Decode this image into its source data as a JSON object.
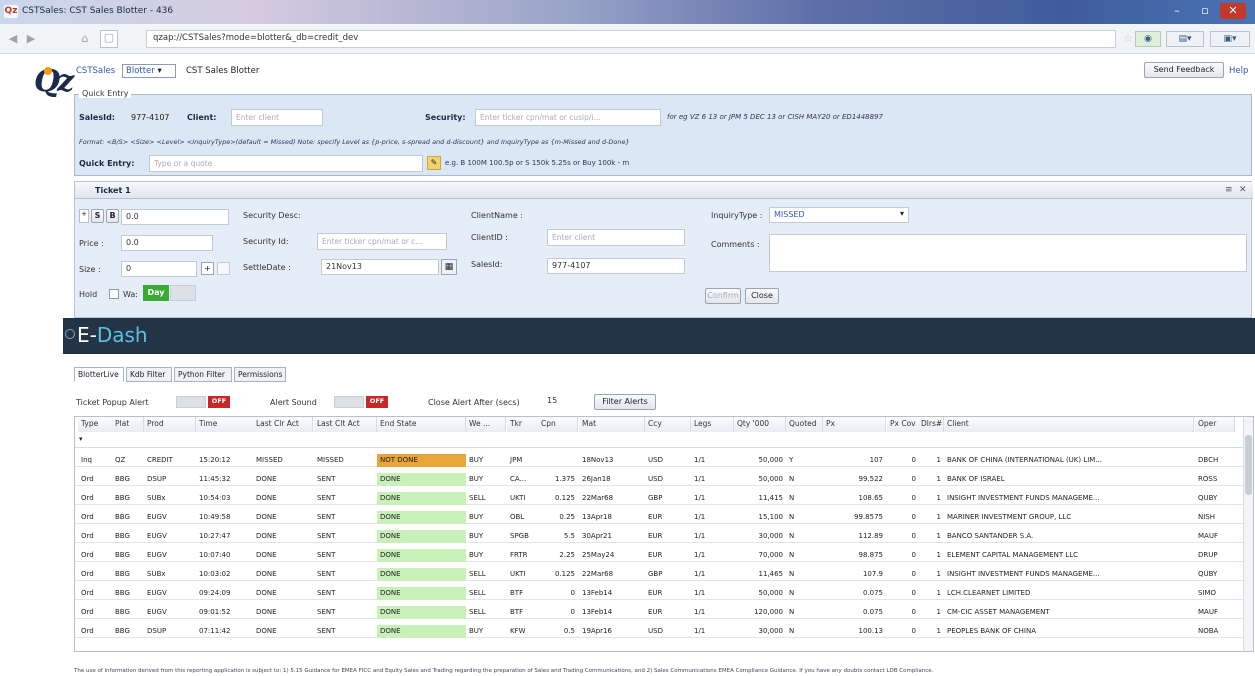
{
  "window": {
    "title": "CSTSales: CST Sales Blotter - 436",
    "icon": "Qz"
  },
  "browser": {
    "url": "qzap://CSTSales?mode=blotter&_db=credit_dev"
  },
  "header": {
    "breadcrumb": "CSTSales",
    "view_select": "Blotter",
    "page_title": "CST Sales Blotter",
    "feedback_label": "Send Feedback",
    "help_label": "Help"
  },
  "quick_entry": {
    "legend": "Quick Entry",
    "salesid_label": "SalesId:",
    "salesid_value": "977-4107",
    "client_label": "Client:",
    "client_placeholder": "Enter client",
    "security_label": "Security:",
    "security_placeholder": "Enter ticker cpn/mat or cusip/i...",
    "security_hint": "for eg VZ 6 13 or JPM 5 DEC 13 or CISH MAY20 or ED1448897",
    "format_text": "Format: <B/S> <Size> <Level> <InquiryType>(default = Missed) Note: specify Level as {p-price, s-spread and d-discount} and InquiryType as {m-Missed and d-Done}",
    "qe_label": "Quick Entry:",
    "qe_placeholder": "Type or a quote",
    "qe_hint": "e.g. B 100M 100.5p or S 150k 5.25s or Buy 100k - m"
  },
  "ticket": {
    "tab_label": "Ticket 1",
    "side_s": "S",
    "side_b": "B",
    "qty": "0.0",
    "price_label": "Price :",
    "price_value": "0.0",
    "size_label": "Size :",
    "size_value": "0",
    "hold_label": "Hold",
    "wait_label": "Wa:",
    "day_label": "Day",
    "sec_desc_label": "Security Desc:",
    "sec_id_label": "Security Id:",
    "sec_id_placeholder": "Enter ticker cpn/mat or c...",
    "settle_label": "SettleDate :",
    "settle_value": "21Nov13",
    "client_name_label": "ClientName :",
    "client_id_label": "ClientID :",
    "client_id_placeholder": "Enter client",
    "salesid_label": "SalesId:",
    "salesid_value": "977-4107",
    "inquiry_label": "InquiryType :",
    "inquiry_value": "MISSED",
    "comments_label": "Comments :",
    "confirm_label": "Confirm",
    "close_label": "Close"
  },
  "dash": {
    "title_e": "E-",
    "title_dash": "Dash"
  },
  "tabs": [
    "BlotterLive",
    "Kdb Filter",
    "Python Filter",
    "Permissions"
  ],
  "alerts": {
    "popup_label": "Ticket Popup Alert",
    "popup_state": "OFF",
    "sound_label": "Alert Sound",
    "sound_state": "OFF",
    "close_after_label": "Close Alert After (secs)",
    "close_after_value": "15",
    "filter_button": "Filter Alerts"
  },
  "columns": [
    "Type",
    "Plat",
    "Prod",
    "Time",
    "Last Clr Act",
    "Last Clt Act",
    "End State",
    "We ...",
    "Tkr",
    "Cpn",
    "Mat",
    "Ccy",
    "Legs",
    "Qty '000",
    "Quoted",
    "Px",
    "Px Cov",
    "Dlrs#",
    "Client",
    "Oper"
  ],
  "rows": [
    [
      "Inq",
      "QZ",
      "CREDIT",
      "15:20:12",
      "MISSED",
      "MISSED",
      "NOT DONE",
      "BUY",
      "JPM",
      "",
      "18Nov13",
      "USD",
      "1/1",
      "50,000",
      "Y",
      "107",
      "0",
      "1",
      "BANK OF CHINA (INTERNATIONAL (UK) LIM...",
      "DBCH"
    ],
    [
      "Ord",
      "BBG",
      "DSUP",
      "11:45:32",
      "DONE",
      "SENT",
      "DONE",
      "BUY",
      "CA...",
      "1.375",
      "26Jan18",
      "USD",
      "1/1",
      "50,000",
      "N",
      "99.522",
      "0",
      "1",
      "BANK OF ISRAEL",
      "ROSS"
    ],
    [
      "Ord",
      "BBG",
      "SUBx",
      "10:54:03",
      "DONE",
      "SENT",
      "DONE",
      "SELL",
      "UKTI",
      "0.125",
      "22Mar68",
      "GBP",
      "1/1",
      "11,415",
      "N",
      "108.65",
      "0",
      "1",
      "INSIGHT INVESTMENT FUNDS MANAGEME...",
      "QUBY"
    ],
    [
      "Ord",
      "BBG",
      "EUGV",
      "10:49:58",
      "DONE",
      "SENT",
      "DONE",
      "BUY",
      "OBL",
      "0.25",
      "13Apr18",
      "EUR",
      "1/1",
      "15,100",
      "N",
      "99.8575",
      "0",
      "1",
      "MARINER INVESTMENT GROUP, LLC",
      "NISH"
    ],
    [
      "Ord",
      "BBG",
      "EUGV",
      "10:27:47",
      "DONE",
      "SENT",
      "DONE",
      "BUY",
      "SPGB",
      "5.5",
      "30Apr21",
      "EUR",
      "1/1",
      "30,000",
      "N",
      "112.89",
      "0",
      "1",
      "BANCO SANTANDER S.A.",
      "MAUF"
    ],
    [
      "Ord",
      "BBG",
      "EUGV",
      "10:07:40",
      "DONE",
      "SENT",
      "DONE",
      "BUY",
      "FRTR",
      "2.25",
      "25May24",
      "EUR",
      "1/1",
      "70,000",
      "N",
      "98.875",
      "0",
      "1",
      "ELEMENT CAPITAL MANAGEMENT LLC",
      "DRUP"
    ],
    [
      "Ord",
      "BBG",
      "SUBx",
      "10:03:02",
      "DONE",
      "SENT",
      "DONE",
      "SELL",
      "UKTI",
      "0.125",
      "22Mar68",
      "GBP",
      "1/1",
      "11,465",
      "N",
      "107.9",
      "0",
      "1",
      "INSIGHT INVESTMENT FUNDS MANAGEME...",
      "QUBY"
    ],
    [
      "Ord",
      "BBG",
      "EUGV",
      "09:24:09",
      "DONE",
      "SENT",
      "DONE",
      "SELL",
      "BTF",
      "0",
      "13Feb14",
      "EUR",
      "1/1",
      "50,000",
      "N",
      "0.075",
      "0",
      "1",
      "LCH.CLEARNET LIMITED",
      "SIMO"
    ],
    [
      "Ord",
      "BBG",
      "EUGV",
      "09:01:52",
      "DONE",
      "SENT",
      "DONE",
      "SELL",
      "BTF",
      "0",
      "13Feb14",
      "EUR",
      "1/1",
      "120,000",
      "N",
      "0.075",
      "0",
      "1",
      "CM-CIC ASSET MANAGEMENT",
      "MAUF"
    ],
    [
      "Ord",
      "BBG",
      "DSUP",
      "07:11:42",
      "DONE",
      "SENT",
      "DONE",
      "BUY",
      "KFW",
      "0.5",
      "19Apr16",
      "USD",
      "1/1",
      "30,000",
      "N",
      "100.13",
      "0",
      "1",
      "PEOPLES BANK OF CHINA",
      "NOBA"
    ]
  ],
  "footer": "The use of information derived from this reporting application is subject to: 1) 5.15 Guidance for EMEA FICC and Equity Sales and Trading regarding the preparation of Sales and Trading Communications, and 2) Sales Communications EMEA Compliance Guidance. If you have any doubts contact LDB Compliance.",
  "colors": {
    "notdone": "#e8a53a",
    "done": "#c8f0b8",
    "off": "#c62828",
    "day": "#3aaa35",
    "dash_bg": "#243447"
  }
}
